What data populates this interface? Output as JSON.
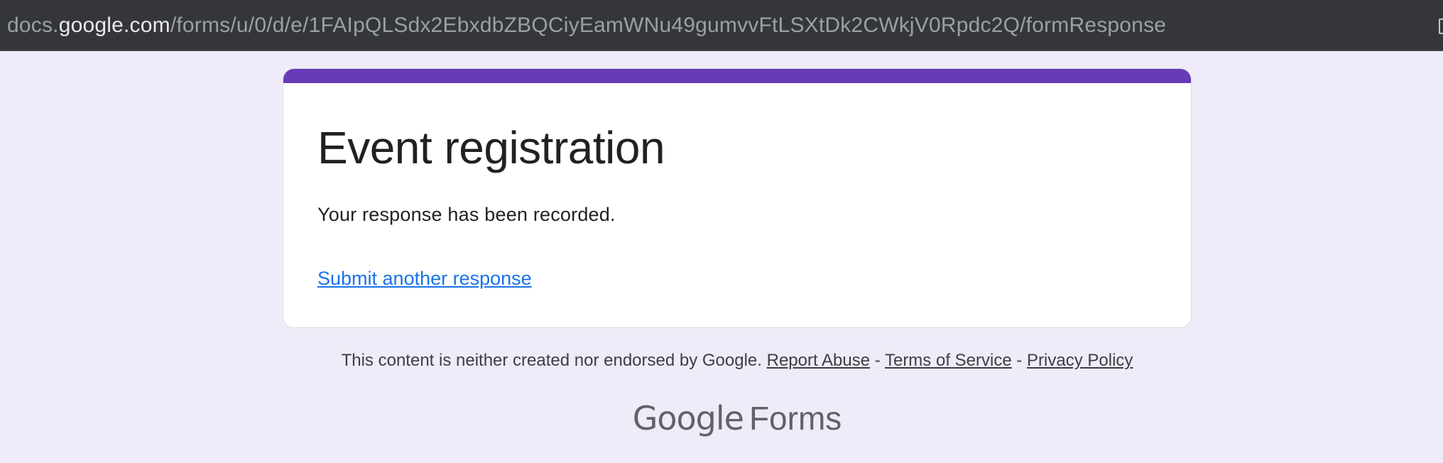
{
  "browser": {
    "url_domain_prefix": "docs.",
    "url_domain_main": "google.com",
    "url_path": "/forms/u/0/d/e/1FAIpQLSdx2EbxdbZBQCiyEamWNu49gumvvFtLSXtDk2CWkjV0Rpdc2Q/formResponse"
  },
  "form": {
    "title": "Event registration",
    "confirmation_message": "Your response has been recorded.",
    "submit_another_link": "Submit another response",
    "accent_color": "#673ab7"
  },
  "footer": {
    "disclaimer": "This content is neither created nor endorsed by Google.",
    "report_abuse": "Report Abuse",
    "separator": "-",
    "terms_of_service": "Terms of Service",
    "privacy_policy": "Privacy Policy"
  },
  "brand": {
    "google": "Google",
    "forms": "Forms"
  }
}
